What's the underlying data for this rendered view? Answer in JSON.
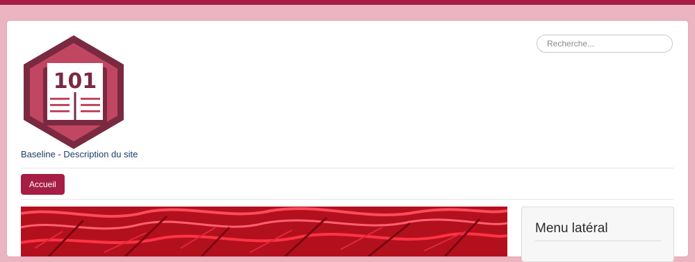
{
  "logo": {
    "number": "101"
  },
  "header": {
    "baseline": "Baseline - Description du site"
  },
  "search": {
    "placeholder": "Recherche..."
  },
  "nav": {
    "items": [
      {
        "label": "Accueil"
      }
    ]
  },
  "sidebar": {
    "title": "Menu latéral"
  },
  "colors": {
    "brand": "#a61e44",
    "background": "#ebb4c0",
    "logo_dark": "#7a2a40",
    "logo_mid": "#c14661"
  }
}
